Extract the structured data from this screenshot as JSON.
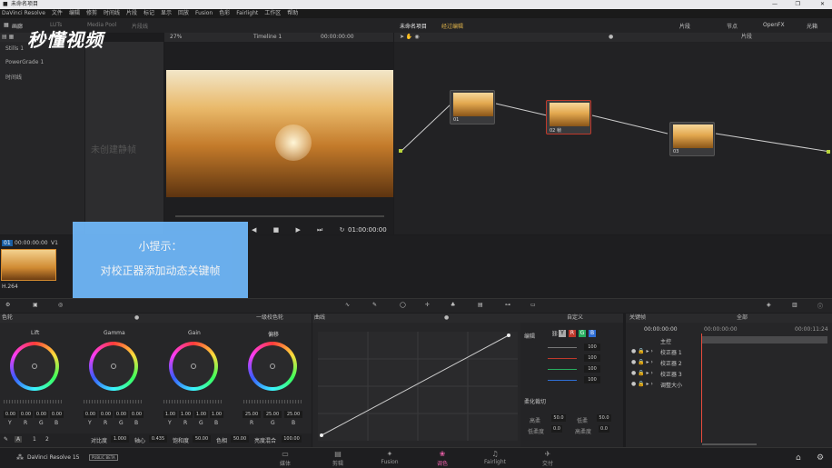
{
  "window": {
    "title": "未命名项目"
  },
  "menu": [
    "DaVinci Resolve",
    "文件",
    "编辑",
    "修剪",
    "时间线",
    "片段",
    "标记",
    "显示",
    "回放",
    "Fusion",
    "色彩",
    "Fairlight",
    "工作区",
    "帮助"
  ],
  "toolbar": {
    "gallery": "画廊",
    "luts": "LUTs",
    "media_pool": "Media Pool",
    "clips": "片段线",
    "project_name": "未命名项目",
    "edited": "经过编辑",
    "clips_btn": "片段",
    "nodes_btn": "节点",
    "openfx": "OpenFX",
    "lightbox": "光箱"
  },
  "viewer": {
    "zoom": "27%",
    "timeline": "Timeline 1",
    "timecode": "00:00:00:00",
    "end_timecode": "01:00:00:00"
  },
  "gallery": {
    "stills": "Stills 1",
    "powergrade": "PowerGrade 1",
    "timeline_label": "时间线",
    "empty": "未创建静帧"
  },
  "nodes": [
    {
      "label": "01"
    },
    {
      "label": "02 帧"
    },
    {
      "label": "03"
    }
  ],
  "node_editor": {
    "mode": "片段"
  },
  "clip": {
    "track": "01",
    "timecode": "00:00:00:00",
    "version": "V1",
    "codec": "H.264"
  },
  "tip": {
    "title": "小提示：",
    "body": "对校正器添加动态关键帧"
  },
  "wheels": {
    "panel": "色轮",
    "mode": "一级校色轮",
    "items": [
      {
        "name": "Lift",
        "vals": [
          "0.00",
          "0.00",
          "0.00",
          "0.00"
        ]
      },
      {
        "name": "Gamma",
        "vals": [
          "0.00",
          "0.00",
          "0.00",
          "0.00"
        ]
      },
      {
        "name": "Gain",
        "vals": [
          "1.00",
          "1.00",
          "1.00",
          "1.00"
        ]
      },
      {
        "name": "偏移",
        "vals": [
          "25.00",
          "25.00",
          "25.00"
        ]
      }
    ],
    "channels": [
      "Y",
      "R",
      "G",
      "B"
    ]
  },
  "wheel_bottom": {
    "mode_a": "A",
    "page1": "1",
    "page2": "2",
    "contrast_label": "对比度",
    "contrast": "1.000",
    "pivot_label": "轴心",
    "pivot": "0.435",
    "sat_label": "饱和度",
    "sat": "50.00",
    "hue_label": "色相",
    "hue": "50.00",
    "lum_label": "亮度混合",
    "lum": "100.00"
  },
  "curves": {
    "panel": "曲线",
    "mode": "自定义",
    "edit": "编辑",
    "vals": [
      "100",
      "100",
      "100",
      "100"
    ],
    "soft": "柔化裁切",
    "high_label": "高柔",
    "high": "50.0",
    "low_label": "低柔",
    "low": "50.0",
    "low_s": "低柔度",
    "low_s_val": "0.0",
    "high_s": "高柔度",
    "high_s_val": "0.0"
  },
  "keyframes": {
    "panel": "关键帧",
    "filter": "全部",
    "timecode": "00:00:00:00",
    "t0": "00:00:00:00",
    "t1": "00:00:11:24",
    "rows": [
      "主控",
      "校正器 1",
      "校正器 2",
      "校正器 3",
      "调整大小"
    ]
  },
  "bottom": {
    "app": "DaVinci Resolve 15",
    "beta": "PUBLIC BETA",
    "nav": [
      "媒体",
      "剪辑",
      "Fusion",
      "调色",
      "Fairlight",
      "交付"
    ]
  },
  "watermark": "秒懂视频"
}
